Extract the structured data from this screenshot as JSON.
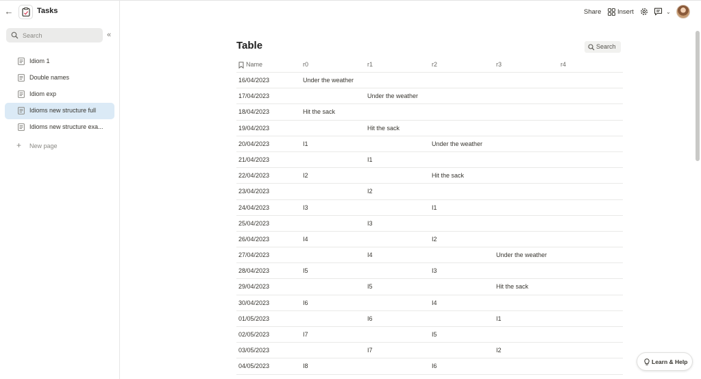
{
  "app": {
    "title": "Tasks"
  },
  "sidebar": {
    "search_placeholder": "Search",
    "items": [
      {
        "label": "Idiom 1",
        "active": false
      },
      {
        "label": "Double names",
        "active": false
      },
      {
        "label": "Idiom exp",
        "active": false
      },
      {
        "label": "Idioms new structure full",
        "active": true
      },
      {
        "label": "Idioms new structure exa...",
        "active": false
      }
    ],
    "new_page_label": "New page"
  },
  "topbar": {
    "share_label": "Share",
    "insert_label": "Insert"
  },
  "table": {
    "title": "Table",
    "search_label": "Search",
    "columns": [
      "Name",
      "r0",
      "r1",
      "r2",
      "r3",
      "r4"
    ],
    "rows": [
      [
        "16/04/2023",
        "Under the weather",
        "",
        "",
        "",
        ""
      ],
      [
        "17/04/2023",
        "",
        "Under the weather",
        "",
        "",
        ""
      ],
      [
        "18/04/2023",
        "Hit the sack",
        "",
        "",
        "",
        ""
      ],
      [
        "19/04/2023",
        "",
        "Hit the sack",
        "",
        "",
        ""
      ],
      [
        "20/04/2023",
        "I1",
        "",
        "Under the weather",
        "",
        ""
      ],
      [
        "21/04/2023",
        "",
        "I1",
        "",
        "",
        ""
      ],
      [
        "22/04/2023",
        "I2",
        "",
        "Hit the sack",
        "",
        ""
      ],
      [
        "23/04/2023",
        "",
        "I2",
        "",
        "",
        ""
      ],
      [
        "24/04/2023",
        "I3",
        "",
        "I1",
        "",
        ""
      ],
      [
        "25/04/2023",
        "",
        "I3",
        "",
        "",
        ""
      ],
      [
        "26/04/2023",
        "I4",
        "",
        "I2",
        "",
        ""
      ],
      [
        "27/04/2023",
        "",
        "I4",
        "",
        "Under the weather",
        ""
      ],
      [
        "28/04/2023",
        "I5",
        "",
        "I3",
        "",
        ""
      ],
      [
        "29/04/2023",
        "",
        "I5",
        "",
        "Hit the sack",
        ""
      ],
      [
        "30/04/2023",
        "I6",
        "",
        "I4",
        "",
        ""
      ],
      [
        "01/05/2023",
        "",
        "I6",
        "",
        "I1",
        ""
      ],
      [
        "02/05/2023",
        "I7",
        "",
        "I5",
        "",
        ""
      ],
      [
        "03/05/2023",
        "",
        "I7",
        "",
        "I2",
        ""
      ],
      [
        "04/05/2023",
        "I8",
        "",
        "I6",
        "",
        ""
      ]
    ]
  },
  "help": {
    "label": "Learn & Help"
  },
  "colors": {
    "accent_active": "#dbeaf6",
    "border": "#e9e9e7"
  }
}
